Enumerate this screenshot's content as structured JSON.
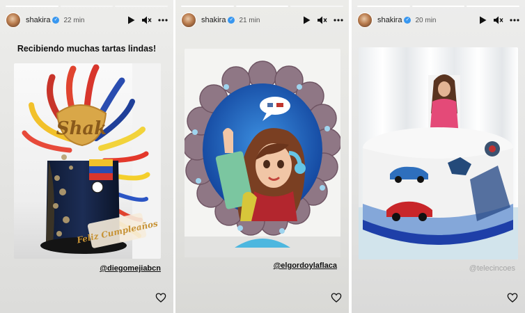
{
  "stories": [
    {
      "username": "shakira",
      "verified": "✓",
      "time": "22 min",
      "caption": "Recibiendo muchas tartas lindas!",
      "cake_text": "Shak",
      "cake_text2": "Feliz Cumpleaños",
      "tag": "@diegomejiabcn",
      "progress_segments": 3,
      "progress_done": 1
    },
    {
      "username": "shakira",
      "verified": "✓",
      "time": "21 min",
      "tag": "@elgordoylaflaca",
      "progress_segments": 3,
      "progress_done": 2
    },
    {
      "username": "shakira",
      "verified": "✓",
      "time": "20 min",
      "watermark": "@telecincoes",
      "progress_segments": 3,
      "progress_done": 3
    }
  ],
  "icons": {
    "play": "play-icon",
    "mute": "mute-icon",
    "more": "more-icon",
    "like": "heart-icon"
  },
  "colors": {
    "verified": "#3897f0",
    "text": "#111111",
    "watermark": "#a5a5a5"
  }
}
